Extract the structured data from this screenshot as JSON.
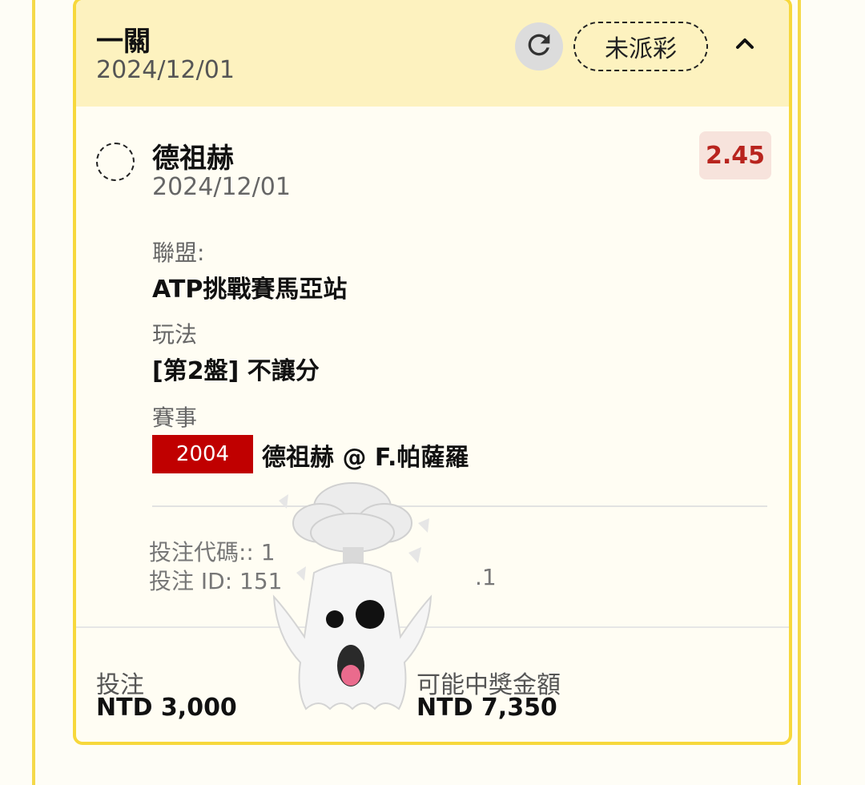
{
  "header": {
    "bet_type": "一關",
    "date": "2024/12/01",
    "status": "未派彩",
    "icons": [
      "refresh-icon",
      "chevron-up-icon"
    ]
  },
  "leg": {
    "selection": "德祖赫",
    "date": "2024/12/01",
    "odds": "2.45",
    "league_label": "聯盟:",
    "league_value": "ATP挑戰賽馬亞站",
    "market_label": "玩法",
    "market_value": "[第2盤] 不讓分",
    "event_label": "賽事",
    "event_code": "2004",
    "event_name": "德祖赫 @ F.帕薩羅"
  },
  "meta": {
    "bet_code": "投注代碼:: 1",
    "bet_id": "投注 ID: 151",
    "bet_id_tail": ".1"
  },
  "footer": {
    "stake_label": "投注",
    "stake_value": "NTD 3,000",
    "payout_label": "可能中獎金額",
    "payout_value": "NTD 7,350"
  },
  "sticker": {
    "icon": "exploding-head-ghost-icon"
  }
}
